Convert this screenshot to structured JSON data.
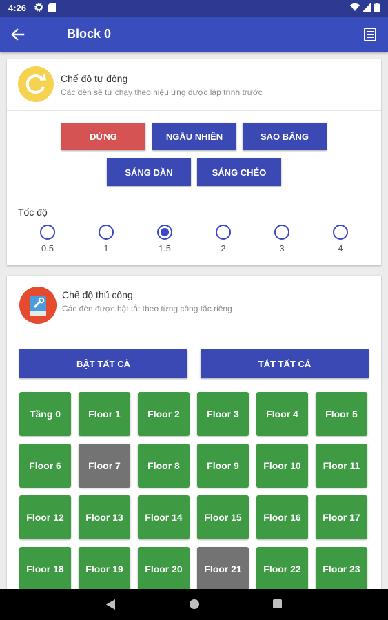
{
  "status": {
    "time": "4:26"
  },
  "appbar": {
    "title": "Block 0"
  },
  "auto_mode": {
    "title": "Chế độ tự động",
    "subtitle": "Các đèn sẽ tự chạy theo hiệu ứng được lập trình trước",
    "buttons": [
      "DỪNG",
      "NGẪU NHIÊN",
      "SAO BĂNG",
      "SÁNG DẦN",
      "SÁNG CHÉO"
    ],
    "speed_label": "Tốc độ",
    "speed_options": [
      "0.5",
      "1",
      "1.5",
      "2",
      "3",
      "4"
    ],
    "speed_selected": "1.5"
  },
  "manual_mode": {
    "title": "Chế độ thủ công",
    "subtitle": "Các đèn được bật tắt theo từng công tắc riêng",
    "all_on": "BẬT TẤT CẢ",
    "all_off": "TẮT TẤT CẢ",
    "floors": [
      "Tầng 0",
      "Floor 1",
      "Floor 2",
      "Floor 3",
      "Floor 4",
      "Floor 5",
      "Floor 6",
      "Floor 7",
      "Floor 8",
      "Floor 9",
      "Floor 10",
      "Floor 11",
      "Floor 12",
      "Floor 13",
      "Floor 14",
      "Floor 15",
      "Floor 16",
      "Floor 17",
      "Floor 18",
      "Floor 19",
      "Floor 20",
      "Floor 21",
      "Floor 22",
      "Floor 23"
    ],
    "floors_off": [
      "Floor 7",
      "Floor 21"
    ]
  },
  "colors": {
    "primary": "#3a4dbd",
    "status_bar": "#2d3a91",
    "stop": "#d65353",
    "on": "#3e9b44",
    "off": "#737373"
  }
}
